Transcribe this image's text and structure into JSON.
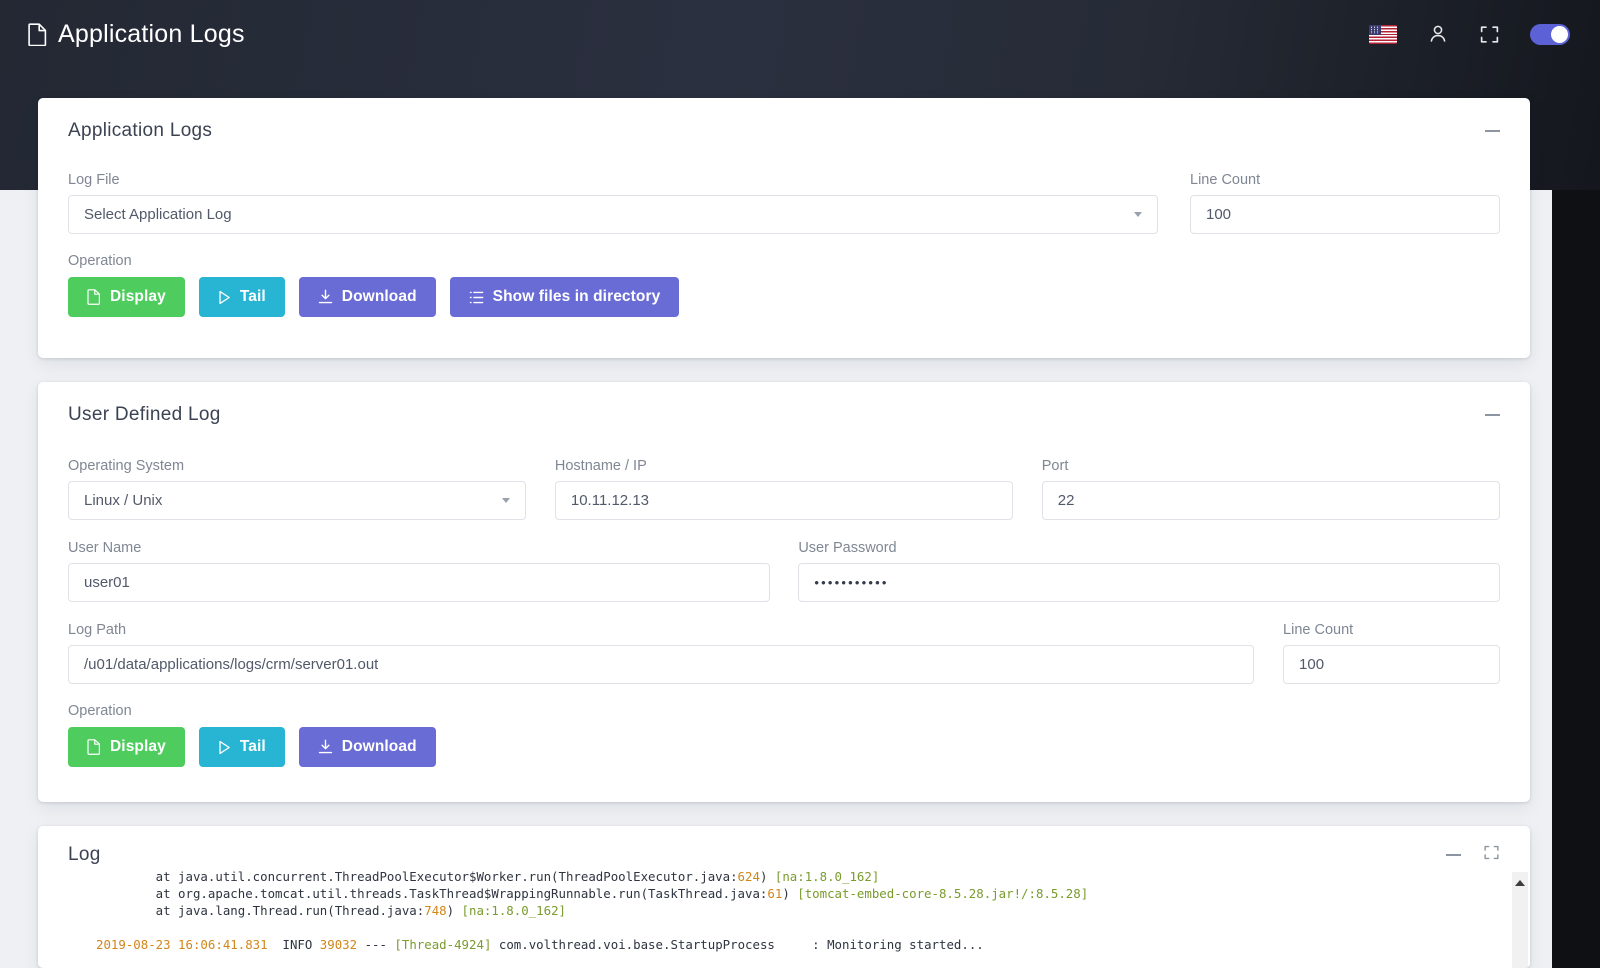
{
  "header": {
    "title": "Application Logs",
    "doc_icon": "document-icon",
    "flag_icon": "us-flag-icon",
    "user_icon": "person-icon",
    "fullscreen_icon": "fullscreen-icon",
    "theme_toggle": "toggle-switch",
    "toggle_on": true,
    "accent_color": "#5c62d6",
    "background_color": "#2b3040"
  },
  "app_log_card": {
    "title": "Application Logs",
    "collapse_icon": "minus-icon",
    "log_file_label": "Log File",
    "log_file_value": "Select Application Log",
    "line_count_label": "Line Count",
    "line_count_value": "100",
    "operation_label": "Operation",
    "buttons": [
      {
        "label": "Display",
        "icon": "file-icon",
        "color": "#4fcc5e"
      },
      {
        "label": "Tail",
        "icon": "play-icon",
        "color": "#28b5d3"
      },
      {
        "label": "Download",
        "icon": "download-icon",
        "color": "#6a6cd6"
      },
      {
        "label": "Show files in directory",
        "icon": "list-icon",
        "color": "#6a6cd6"
      }
    ]
  },
  "user_log_card": {
    "title": "User Defined Log",
    "collapse_icon": "minus-icon",
    "os_label": "Operating System",
    "os_value": "Linux / Unix",
    "host_label": "Hostname / IP",
    "host_value": "10.11.12.13",
    "port_label": "Port",
    "port_value": "22",
    "username_label": "User Name",
    "username_value": "user01",
    "password_label": "User Password",
    "password_value": "•••••••••••",
    "logpath_label": "Log Path",
    "logpath_value": "/u01/data/applications/logs/crm/server01.out",
    "line_count_label": "Line Count",
    "line_count_value": "100",
    "operation_label": "Operation",
    "buttons": [
      {
        "label": "Display",
        "icon": "file-icon",
        "color": "#4fcc5e"
      },
      {
        "label": "Tail",
        "icon": "play-icon",
        "color": "#28b5d3"
      },
      {
        "label": "Download",
        "icon": "download-icon",
        "color": "#6a6cd6"
      }
    ]
  },
  "log_card": {
    "title": "Log",
    "collapse_icon": "minus-icon",
    "fullscreen_icon": "fullscreen-icon",
    "lines": [
      {
        "segments": [
          {
            "text": "        at java.util.concurrent.ThreadPoolExecutor$Worker.run(ThreadPoolExecutor.java:",
            "color": "dim"
          },
          {
            "text": "624",
            "color": "orange"
          },
          {
            "text": ") ",
            "color": "dim"
          },
          {
            "text": "[na:1.8.0_162]",
            "color": "green"
          }
        ]
      },
      {
        "segments": [
          {
            "text": "        at org.apache.tomcat.util.threads.TaskThread$WrappingRunnable.run(TaskThread.java:",
            "color": "dim"
          },
          {
            "text": "61",
            "color": "orange"
          },
          {
            "text": ") ",
            "color": "dim"
          },
          {
            "text": "[tomcat-embed-core-8.5.28.jar!/:8.5.28]",
            "color": "green"
          }
        ]
      },
      {
        "segments": [
          {
            "text": "        at java.lang.Thread.run(Thread.java:",
            "color": "dim"
          },
          {
            "text": "748",
            "color": "orange"
          },
          {
            "text": ") ",
            "color": "dim"
          },
          {
            "text": "[na:1.8.0_162]",
            "color": "green"
          }
        ]
      },
      {
        "segments": []
      },
      {
        "segments": [
          {
            "text": "2019-08-23 16:06:41.831",
            "color": "orange"
          },
          {
            "text": "  INFO ",
            "color": "dim"
          },
          {
            "text": "39032",
            "color": "orange"
          },
          {
            "text": " --- ",
            "color": "dim"
          },
          {
            "text": "[Thread-4924]",
            "color": "green"
          },
          {
            "text": " com.volthread.voi.base.StartupProcess     : Monitoring started...",
            "color": "dim"
          }
        ]
      }
    ]
  }
}
